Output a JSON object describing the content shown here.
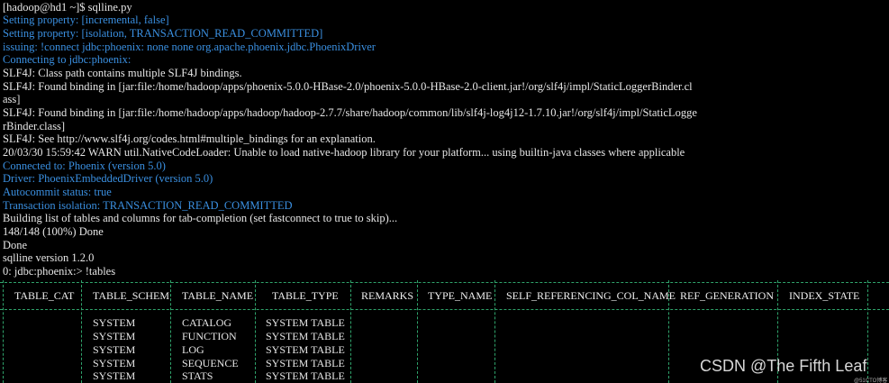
{
  "terminal": {
    "lines": [
      {
        "text": "[hadoop@hd1 ~]$ sqlline.py",
        "color": "white"
      },
      {
        "text": "Setting property: [incremental, false]",
        "color": "blue"
      },
      {
        "text": "Setting property: [isolation, TRANSACTION_READ_COMMITTED]",
        "color": "blue"
      },
      {
        "text": "issuing: !connect jdbc:phoenix: none none org.apache.phoenix.jdbc.PhoenixDriver",
        "color": "blue"
      },
      {
        "text": "Connecting to jdbc:phoenix:",
        "color": "blue"
      },
      {
        "text": "SLF4J: Class path contains multiple SLF4J bindings.",
        "color": "white"
      },
      {
        "text": "SLF4J: Found binding in [jar:file:/home/hadoop/apps/phoenix-5.0.0-HBase-2.0/phoenix-5.0.0-HBase-2.0-client.jar!/org/slf4j/impl/StaticLoggerBinder.cl",
        "color": "white"
      },
      {
        "text": "ass]",
        "color": "white"
      },
      {
        "text": "SLF4J: Found binding in [jar:file:/home/hadoop/apps/hadoop/hadoop-2.7.7/share/hadoop/common/lib/slf4j-log4j12-1.7.10.jar!/org/slf4j/impl/StaticLogge",
        "color": "white"
      },
      {
        "text": "rBinder.class]",
        "color": "white"
      },
      {
        "text": "SLF4J: See http://www.slf4j.org/codes.html#multiple_bindings for an explanation.",
        "color": "white"
      },
      {
        "text": "20/03/30 15:59:42 WARN util.NativeCodeLoader: Unable to load native-hadoop library for your platform... using builtin-java classes where applicable",
        "color": "white"
      },
      {
        "text": "Connected to: Phoenix (version 5.0)",
        "color": "blue"
      },
      {
        "text": "Driver: PhoenixEmbeddedDriver (version 5.0)",
        "color": "blue"
      },
      {
        "text": "Autocommit status: true",
        "color": "blue"
      },
      {
        "text": "Transaction isolation: TRANSACTION_READ_COMMITTED",
        "color": "blue"
      },
      {
        "text": "Building list of tables and columns for tab-completion (set fastconnect to true to skip)...",
        "color": "white"
      },
      {
        "text": "148/148 (100%) Done",
        "color": "white"
      },
      {
        "text": "Done",
        "color": "white"
      },
      {
        "text": "sqlline version 1.2.0",
        "color": "white"
      },
      {
        "text": "0: jdbc:phoenix:> !tables",
        "color": "white"
      }
    ]
  },
  "tables_result": {
    "headers": [
      "TABLE_CAT",
      "TABLE_SCHEM",
      "TABLE_NAME",
      "TABLE_TYPE",
      "REMARKS",
      "TYPE_NAME",
      "SELF_REFERENCING_COL_NAME",
      "REF_GENERATION",
      "INDEX_STATE"
    ],
    "rows": [
      [
        "",
        "SYSTEM",
        "CATALOG",
        "SYSTEM TABLE",
        "",
        "",
        "",
        "",
        ""
      ],
      [
        "",
        "SYSTEM",
        "FUNCTION",
        "SYSTEM TABLE",
        "",
        "",
        "",
        "",
        ""
      ],
      [
        "",
        "SYSTEM",
        "LOG",
        "SYSTEM TABLE",
        "",
        "",
        "",
        "",
        ""
      ],
      [
        "",
        "SYSTEM",
        "SEQUENCE",
        "SYSTEM TABLE",
        "",
        "",
        "",
        "",
        ""
      ],
      [
        "",
        "SYSTEM",
        "STATS",
        "SYSTEM TABLE",
        "",
        "",
        "",
        "",
        ""
      ]
    ]
  },
  "watermark": {
    "text": "CSDN @The Fifth Leaf",
    "small": "@51CTO博客"
  },
  "colors": {
    "background": "#000000",
    "text": "#e6e6e6",
    "info_blue": "#3a8fe0",
    "table_border": "#2fa36b"
  }
}
